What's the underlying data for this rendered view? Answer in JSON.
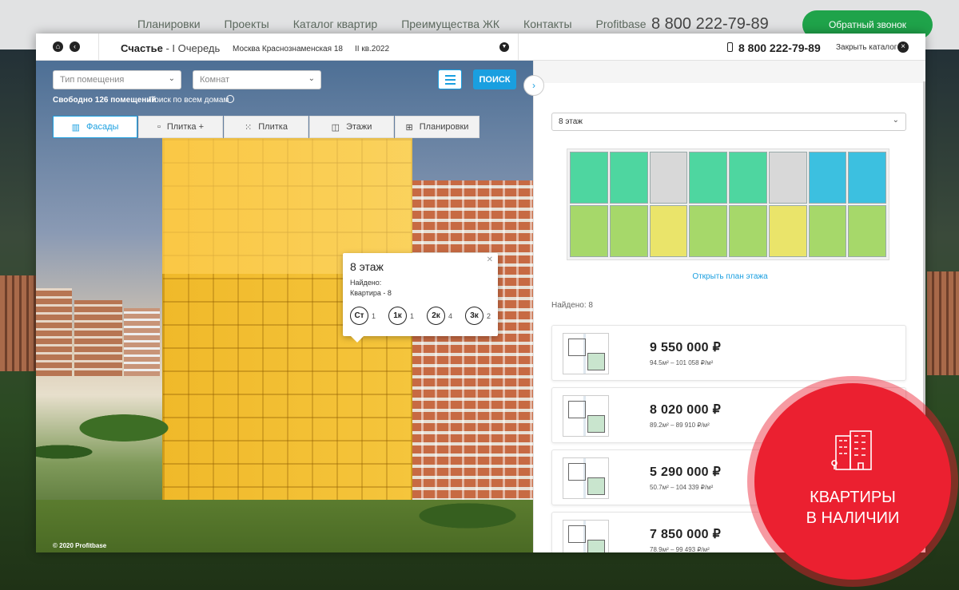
{
  "topnav": {
    "links": [
      "Планировки",
      "Проекты",
      "Каталог квартир",
      "Преимущества ЖК",
      "Контакты",
      "Profitbase"
    ],
    "phone": "8 800 222-79-89",
    "callback": "Обратный звонок"
  },
  "header": {
    "project": "Счастье",
    "queue": "- I Очередь",
    "address": "Москва Краснознаменская 18",
    "date": "II кв.2022",
    "phone": "8 800 222-79-89",
    "close_catalog": "Закрыть каталог"
  },
  "filters": {
    "type_placeholder": "Тип помещения",
    "rooms_placeholder": "Комнат",
    "search": "ПОИСК",
    "free_count": "Свободно 126 помещений",
    "search_all": "Поиск по всем домам"
  },
  "tabs": [
    {
      "label": "Фасады",
      "icon": "facade-icon",
      "glyph": "▥"
    },
    {
      "label": "Плитка +",
      "icon": "tiles-plus-icon",
      "glyph": "▫"
    },
    {
      "label": "Плитка",
      "icon": "tiles-icon",
      "glyph": "⁙"
    },
    {
      "label": "Этажи",
      "icon": "floors-icon",
      "glyph": "◫"
    },
    {
      "label": "Планировки",
      "icon": "layouts-icon",
      "glyph": "⊞"
    }
  ],
  "popup": {
    "title": "8 этаж",
    "found": "Найдено:",
    "apartments": "Квартира - 8",
    "rooms": [
      {
        "label": "Ст",
        "count": "1"
      },
      {
        "label": "1к",
        "count": "1"
      },
      {
        "label": "2к",
        "count": "4"
      },
      {
        "label": "3к",
        "count": "2"
      }
    ]
  },
  "copyright": "© 2020 Profitbase",
  "right": {
    "floor_select": "8 этаж",
    "open_plan": "Открыть план этажа",
    "found": "Найдено: 8",
    "listings": [
      {
        "price": "9 550 000 ₽",
        "area": "94.5м² – 101 058 ₽/м²"
      },
      {
        "price": "8 020 000 ₽",
        "area": "89.2м² – 89 910 ₽/м²"
      },
      {
        "price": "5 290 000 ₽",
        "area": "50.7м² – 104 339 ₽/м²"
      },
      {
        "price": "7 850 000 ₽",
        "area": "78.9м² – 99 493 ₽/м²"
      }
    ]
  },
  "badge": {
    "line1": "КВАРТИРЫ",
    "line2": "В НАЛИЧИИ",
    "icon": "building-icon"
  },
  "colors": {
    "accent": "#1a9fe0",
    "badge": "#eb2030",
    "green": "#1fa34a",
    "facade_highlight": "#f0b92a"
  }
}
